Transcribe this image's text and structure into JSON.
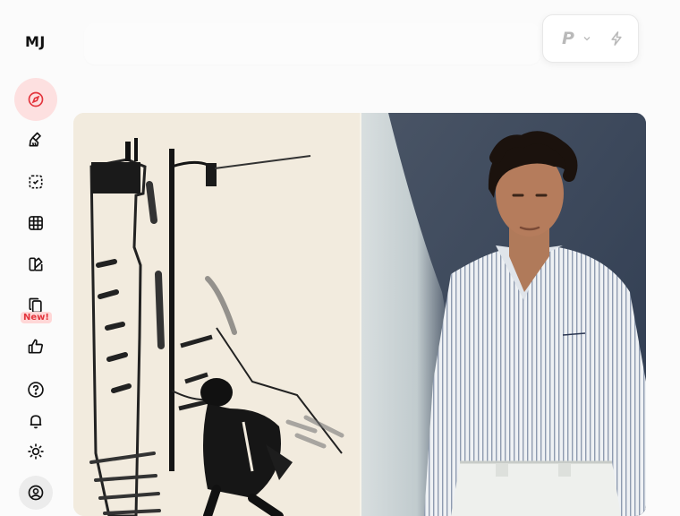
{
  "app": {
    "logo": "MJ"
  },
  "sidebar": {
    "items": [
      {
        "name": "explore",
        "icon": "compass-icon",
        "active": true
      },
      {
        "name": "create",
        "icon": "paintbrush-icon"
      },
      {
        "name": "edit",
        "icon": "edit-frame-icon"
      },
      {
        "name": "organize",
        "icon": "grid-icon"
      },
      {
        "name": "personalize",
        "icon": "palette-icon"
      },
      {
        "name": "moodboards",
        "icon": "copy-icon",
        "badge": "New!"
      },
      {
        "name": "rate",
        "icon": "thumbs-up-icon"
      },
      {
        "name": "help",
        "icon": "help-circle-icon"
      },
      {
        "name": "updates",
        "icon": "bell-icon"
      },
      {
        "name": "theme",
        "icon": "sun-icon"
      },
      {
        "name": "profile",
        "icon": "user-circle-icon"
      }
    ]
  },
  "search": {
    "placeholder": "",
    "value": ""
  },
  "prompt_controls": {
    "p_label": "P",
    "icons": [
      "chevron-down-icon",
      "lightning-icon"
    ]
  },
  "gallery": {
    "images": [
      {
        "description": "ink-sketch-street-figure",
        "icon": "image"
      },
      {
        "description": "man-striped-shirt-photo",
        "icon": "image"
      }
    ]
  },
  "colors": {
    "background": "#fbfbfb",
    "accent": "#e3343c",
    "active_bg": "#fde0e0"
  }
}
